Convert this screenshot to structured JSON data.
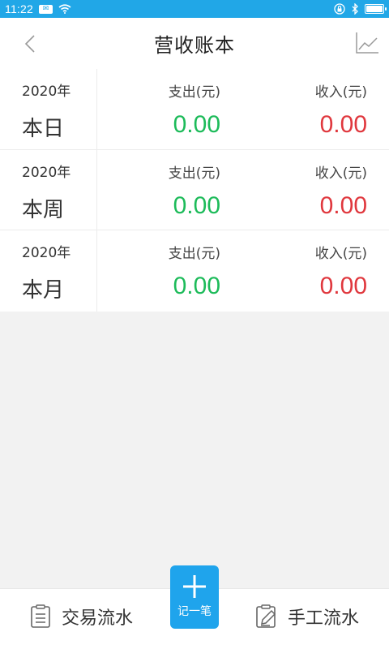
{
  "status_bar": {
    "time": "11:22",
    "msg_badge": "✉"
  },
  "header": {
    "title": "营收账本"
  },
  "summary": [
    {
      "year": "2020年",
      "period": "本日",
      "expense_label": "支出(元)",
      "expense": "0.00",
      "income_label": "收入(元)",
      "income": "0.00"
    },
    {
      "year": "2020年",
      "period": "本周",
      "expense_label": "支出(元)",
      "expense": "0.00",
      "income_label": "收入(元)",
      "income": "0.00"
    },
    {
      "year": "2020年",
      "period": "本月",
      "expense_label": "支出(元)",
      "expense": "0.00",
      "income_label": "收入(元)",
      "income": "0.00"
    }
  ],
  "bottom_bar": {
    "transactions_label": "交易流水",
    "add_label": "记一笔",
    "manual_label": "手工流水"
  },
  "colors": {
    "accent": "#1fa4ec",
    "status_bar": "#21a7e7",
    "expense": "#1dbb5a",
    "income": "#e0383e"
  },
  "icons": {
    "back": "chevron-left-icon",
    "chart": "line-chart-icon",
    "transactions": "list-document-icon",
    "manual": "edit-document-icon",
    "add": "plus-icon"
  }
}
